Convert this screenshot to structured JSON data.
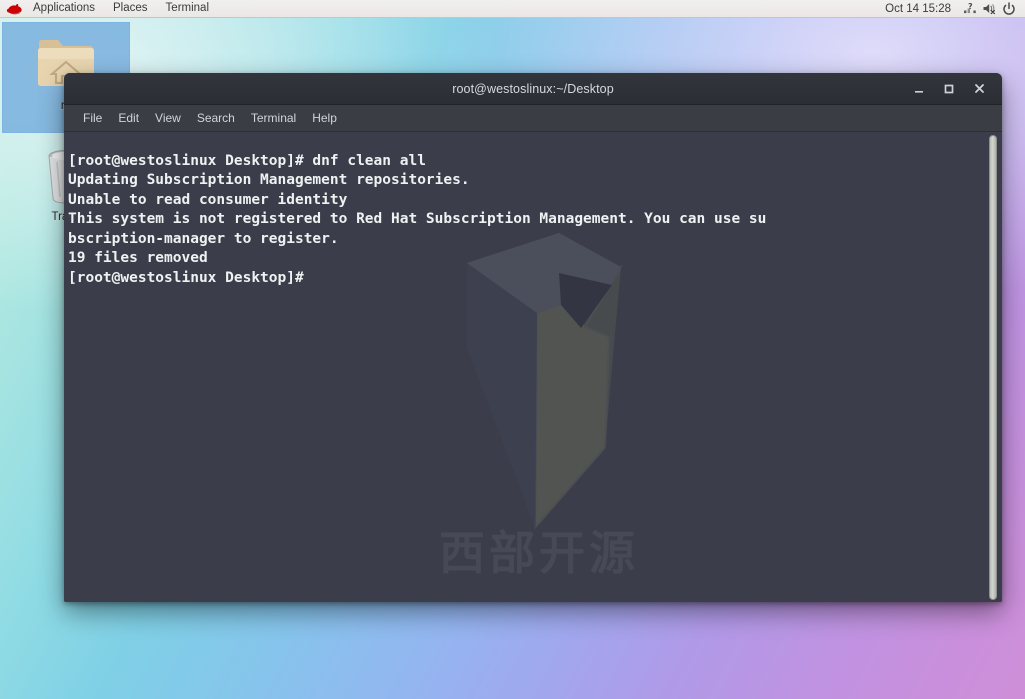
{
  "panel": {
    "logo_icon": "redhat-logo-icon",
    "menus": [
      {
        "label": "Applications"
      },
      {
        "label": "Places"
      },
      {
        "label": "Terminal"
      }
    ],
    "clock": "Oct 14  15:28",
    "tray": [
      {
        "icon": "network-unknown-icon"
      },
      {
        "icon": "volume-muted-icon"
      },
      {
        "icon": "power-icon"
      }
    ]
  },
  "desktop": {
    "icons": [
      {
        "name": "home-folder",
        "label": "ro",
        "icon": "home-folder-icon",
        "selected": true
      },
      {
        "name": "trash",
        "label": "Trash",
        "icon": "trash-icon",
        "selected": false
      }
    ]
  },
  "terminal": {
    "title": "root@westoslinux:~/Desktop",
    "window_buttons": {
      "minimize": "–",
      "maximize": "□",
      "close": "✕"
    },
    "menu": [
      {
        "label": "File"
      },
      {
        "label": "Edit"
      },
      {
        "label": "View"
      },
      {
        "label": "Search"
      },
      {
        "label": "Terminal"
      },
      {
        "label": "Help"
      }
    ],
    "content": "[root@westoslinux Desktop]# dnf clean all\nUpdating Subscription Management repositories.\nUnable to read consumer identity\nThis system is not registered to Red Hat Subscription Management. You can use su\nbscription-manager to register.\n19 files removed\n[root@westoslinux Desktop]# ",
    "watermark_text": "西部开源",
    "watermark_logo": "westos-arrow-logo-icon",
    "scrollbar": {
      "name": "terminal-scrollbar"
    }
  },
  "colors": {
    "panel_bg": "#efedec",
    "terminal_bg": "#3b3e4a",
    "titlebar_bg": "#2e3138",
    "terminal_fg": "#f0f1f2",
    "selection_blue": "#5698d6",
    "redhat_red": "#cc0000"
  }
}
